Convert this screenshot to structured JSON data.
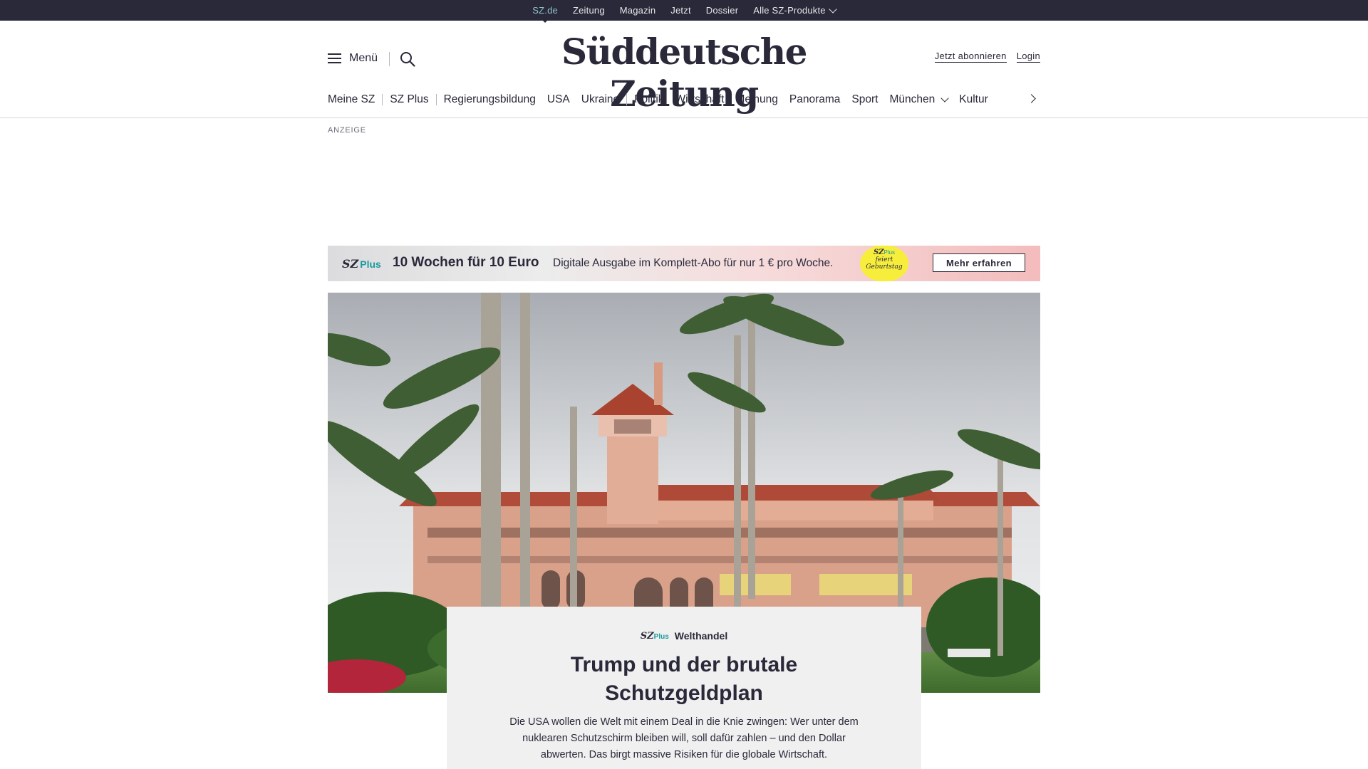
{
  "topbar": {
    "items": [
      {
        "label": "SZ.de",
        "active": true
      },
      {
        "label": "Zeitung"
      },
      {
        "label": "Magazin"
      },
      {
        "label": "Jetzt"
      },
      {
        "label": "Dossier"
      },
      {
        "label": "Alle SZ-Produkte",
        "dropdown": true
      }
    ]
  },
  "header": {
    "menu_label": "Menü",
    "logo_text": "Süddeutsche Zeitung",
    "subscribe_label": "Jetzt abonnieren",
    "login_label": "Login",
    "icons": [
      "hamburger-icon",
      "search-icon"
    ]
  },
  "nav": {
    "items": [
      "Meine SZ",
      "SZ Plus",
      "Regierungsbildung",
      "USA",
      "Ukraine",
      "Politik",
      "Wirtschaft",
      "Meinung",
      "Panorama",
      "Sport",
      "München",
      "Kultur"
    ],
    "dropdown_item": "München"
  },
  "ad": {
    "label": "ANZEIGE"
  },
  "promo": {
    "brand_sz": "SZ",
    "brand_plus": "Plus",
    "headline": "10 Wochen für 10 Euro",
    "subline": "Digitale Ausgabe im Komplett-Abo für nur 1 € pro Woche.",
    "badge_sz": "SZ",
    "badge_plus": "Plus",
    "badge_line1": "feiert",
    "badge_line2": "Geburtstag",
    "cta_label": "Mehr erfahren",
    "badge_color": "#f7ee3c"
  },
  "article": {
    "brand_sz": "SZ",
    "brand_plus": "Plus",
    "kicker": "Welthandel",
    "title": "Trump und der brutale Schutzgeldplan",
    "teaser": "Die USA wollen die Welt mit einem Deal in die Knie zwingen: Wer unter dem nuklearen Schutzschirm bleiben will, soll dafür zahlen – und den Dollar abwerten. Das birgt massive Risiken für die globale Wirtschaft."
  },
  "colors": {
    "dark": "#29293a",
    "accent": "#1a9aa0",
    "topbar_active": "#8fc3c9"
  }
}
